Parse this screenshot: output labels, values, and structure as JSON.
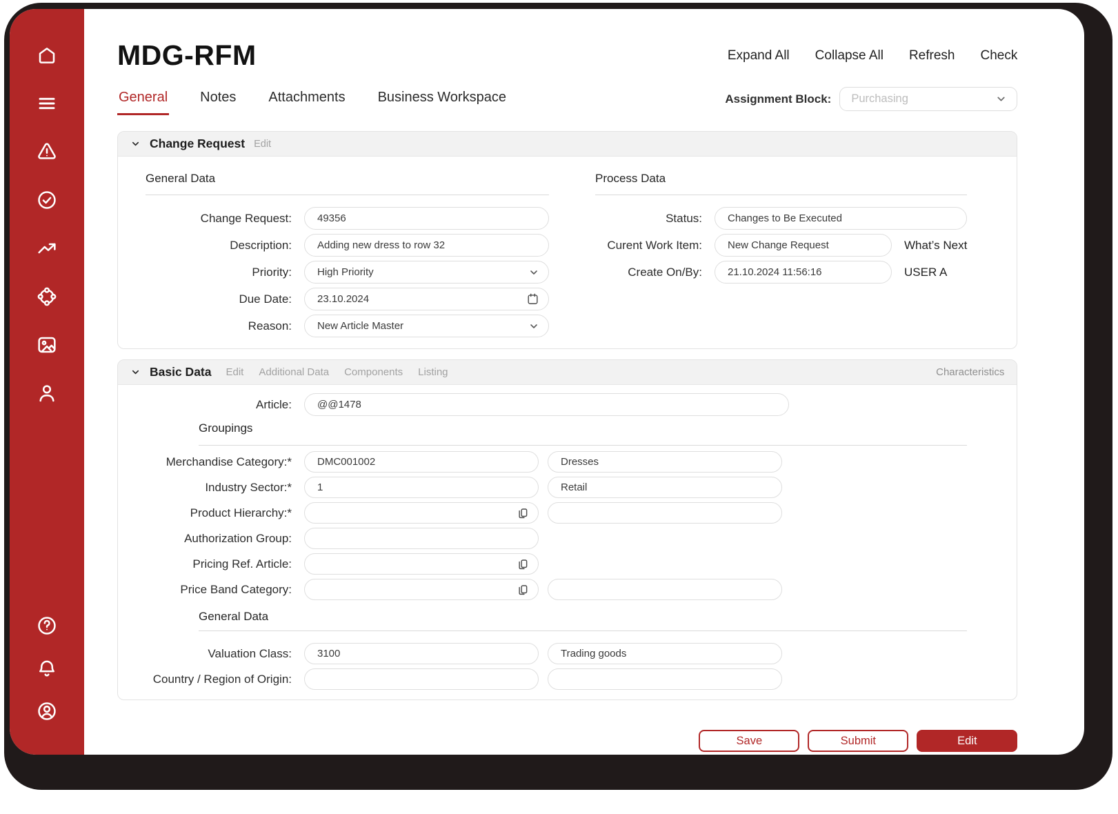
{
  "colors": {
    "brand_red": "#b12727",
    "frame_dark": "#201a1a",
    "panel_header_bg": "#f2f2f2"
  },
  "sidebar": {
    "icons_top": [
      "home",
      "menu",
      "warning",
      "check-circle",
      "trending-up",
      "share-network",
      "image",
      "user"
    ],
    "icons_bottom": [
      "help",
      "bell",
      "account"
    ]
  },
  "header": {
    "title": "MDG-RFM",
    "actions": [
      {
        "label": "Expand All"
      },
      {
        "label": "Collapse All"
      },
      {
        "label": "Refresh"
      },
      {
        "label": "Check"
      }
    ],
    "tabs": [
      {
        "label": "General",
        "active": true
      },
      {
        "label": "Notes",
        "active": false
      },
      {
        "label": "Attachments",
        "active": false
      },
      {
        "label": "Business Workspace",
        "active": false
      }
    ],
    "assignment_block_label": "Assignment Block:",
    "assignment_block_value": "Purchasing"
  },
  "change_request": {
    "title": "Change Request",
    "edit_link": "Edit",
    "general": {
      "heading": "General Data",
      "change_request": {
        "label": "Change Request:",
        "value": "49356"
      },
      "description": {
        "label": "Description:",
        "value": "Adding new dress to row 32"
      },
      "priority": {
        "label": "Priority:",
        "value": "High Priority"
      },
      "due_date": {
        "label": "Due Date:",
        "value": "23.10.2024"
      },
      "reason": {
        "label": "Reason:",
        "value": "New Article Master"
      }
    },
    "process": {
      "heading": "Process Data",
      "status": {
        "label": "Status:",
        "value": "Changes to Be Executed"
      },
      "work_item": {
        "label": "Curent Work Item:",
        "value": "New Change Request",
        "suffix": "What’s Next"
      },
      "created": {
        "label": "Create On/By:",
        "value": "21.10.2024 11:56:16",
        "suffix": "USER A"
      }
    }
  },
  "basic_data": {
    "title": "Basic Data",
    "links": [
      {
        "label": "Edit"
      },
      {
        "label": "Additional Data"
      },
      {
        "label": "Components"
      },
      {
        "label": "Listing"
      }
    ],
    "characteristics_link": "Characteristics",
    "article": {
      "label": "Article:",
      "value": "@@1478"
    },
    "groupings": {
      "heading": "Groupings",
      "merchandise_category": {
        "label": "Merchandise Category:*",
        "value": "DMC001002",
        "value2": "Dresses"
      },
      "industry_sector": {
        "label": "Industry Sector:*",
        "value": "1",
        "value2": "Retail"
      },
      "product_hierarchy": {
        "label": "Product Hierarchy:*",
        "value": "",
        "value2": ""
      },
      "authorization_group": {
        "label": "Authorization Group:",
        "value": ""
      },
      "pricing_ref_article": {
        "label": "Pricing Ref. Article:",
        "value": ""
      },
      "price_band_category": {
        "label": "Price Band Category:",
        "value": "",
        "value2": ""
      }
    },
    "general": {
      "heading": "General Data",
      "valuation_class": {
        "label": "Valuation Class:",
        "value": "3100",
        "value2": "Trading goods"
      },
      "country_origin": {
        "label": "Country / Region of Origin:",
        "value": "",
        "value2": ""
      }
    }
  },
  "footer": {
    "save": "Save",
    "submit": "Submit",
    "edit": "Edit"
  }
}
